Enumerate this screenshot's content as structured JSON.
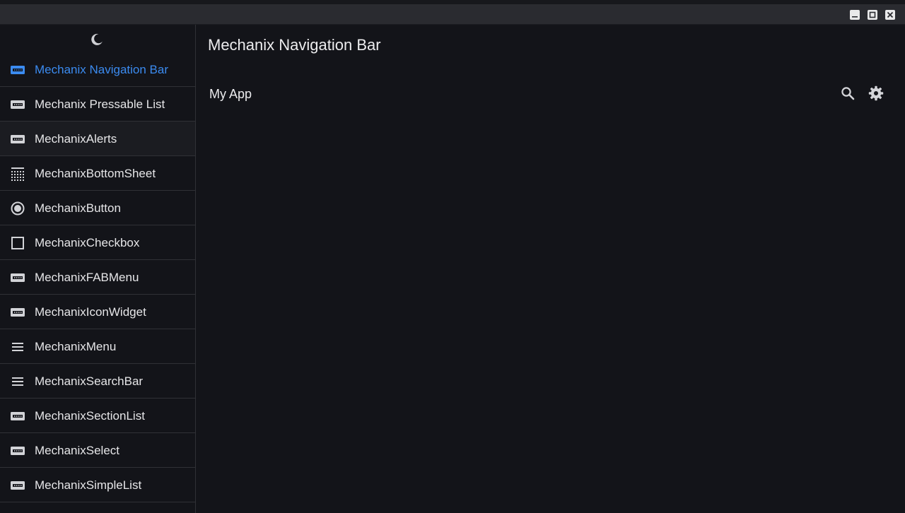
{
  "window": {
    "controls": [
      "minimize-icon",
      "maximize-icon",
      "close-icon"
    ]
  },
  "sidebar": {
    "theme_toggle_icon": "moon-icon",
    "items": [
      {
        "label": "Mechanix Navigation Bar",
        "icon": "nav-bar-icon",
        "active": true
      },
      {
        "label": "Mechanix Pressable List",
        "icon": "widget-icon"
      },
      {
        "label": "MechanixAlerts",
        "icon": "widget-icon",
        "hover": true
      },
      {
        "label": "MechanixBottomSheet",
        "icon": "dotted-grid-icon"
      },
      {
        "label": "MechanixButton",
        "icon": "radio-button-icon"
      },
      {
        "label": "MechanixCheckbox",
        "icon": "checkbox-icon"
      },
      {
        "label": "MechanixFABMenu",
        "icon": "widget-icon"
      },
      {
        "label": "MechanixIconWidget",
        "icon": "widget-icon"
      },
      {
        "label": "MechanixMenu",
        "icon": "menu-lines-icon"
      },
      {
        "label": "MechanixSearchBar",
        "icon": "menu-lines-icon"
      },
      {
        "label": "MechanixSectionList",
        "icon": "widget-icon"
      },
      {
        "label": "MechanixSelect",
        "icon": "widget-icon"
      },
      {
        "label": "MechanixSimpleList",
        "icon": "widget-icon"
      }
    ]
  },
  "main": {
    "title": "Mechanix Navigation Bar",
    "demo_navbar": {
      "title": "My App",
      "actions": [
        "search-icon",
        "gear-icon"
      ]
    }
  },
  "colors": {
    "background": "#131419",
    "accent": "#3b8bf0",
    "text": "#e6e6e8",
    "divider": "#303136",
    "titlebar": "#2a2b30"
  }
}
